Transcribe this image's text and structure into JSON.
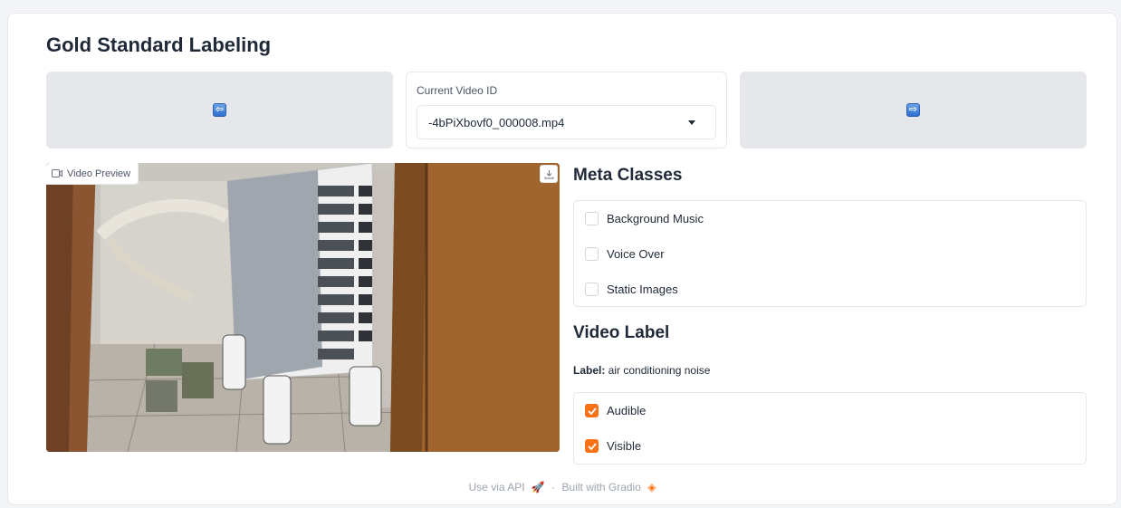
{
  "app": {
    "title": "Gold Standard Labeling"
  },
  "nav": {
    "prev_icon": "left-arrow-icon",
    "prev_glyph": "⇦",
    "next_icon": "right-arrow-icon",
    "next_glyph": "⇨"
  },
  "video_id": {
    "label": "Current Video ID",
    "value": "-4bPiXbovf0_000008.mp4"
  },
  "video": {
    "tag_label": "Video Preview"
  },
  "meta_classes": {
    "heading": "Meta Classes",
    "items": [
      {
        "label": "Background Music",
        "checked": false
      },
      {
        "label": "Voice Over",
        "checked": false
      },
      {
        "label": "Static Images",
        "checked": false
      }
    ]
  },
  "video_label": {
    "heading": "Video Label",
    "label_prefix": "Label:",
    "label_value": " air conditioning noise",
    "items": [
      {
        "label": "Audible",
        "checked": true
      },
      {
        "label": "Visible",
        "checked": true
      }
    ]
  },
  "footer": {
    "api_text": "Use via API",
    "separator": "·",
    "built_text": "Built with Gradio"
  },
  "colors": {
    "accent": "#f97316",
    "button_bg": "#e5e7eb",
    "arrow_blue": "#2f6fd1"
  }
}
